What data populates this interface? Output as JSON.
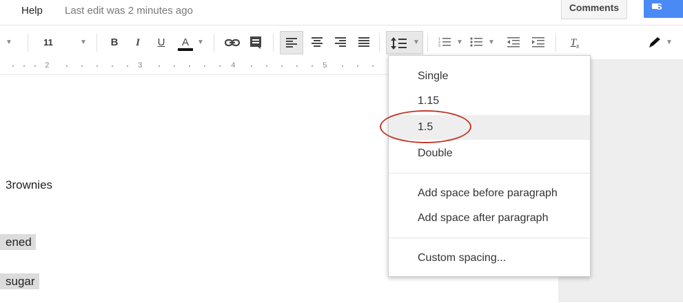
{
  "topbar": {
    "help_label": "Help",
    "last_edit": "Last edit was 2 minutes ago",
    "comments_label": "Comments",
    "share_label": "S"
  },
  "toolbar": {
    "font_size": "11",
    "bold": "B",
    "italic": "I",
    "underline": "U",
    "text_color": "A",
    "link_icon": "link-icon",
    "comment_icon": "insert-comment-icon",
    "align_left_icon": "align-left-icon",
    "align_center_icon": "align-center-icon",
    "align_right_icon": "align-right-icon",
    "align_justify_icon": "align-justify-icon",
    "line_spacing_icon": "line-spacing-icon",
    "numbered_list_icon": "numbered-list-icon",
    "bulleted_list_icon": "bulleted-list-icon",
    "decrease_indent_icon": "decrease-indent-icon",
    "increase_indent_icon": "increase-indent-icon",
    "clear_formatting": "T",
    "editing_icon": "pencil-icon"
  },
  "ruler": {
    "labels": [
      "2",
      "3",
      "4",
      "5"
    ]
  },
  "document": {
    "lines": [
      "3rownies",
      "ened",
      "sugar"
    ]
  },
  "line_spacing_menu": {
    "items": [
      "Single",
      "1.15",
      "1.5",
      "Double"
    ],
    "actions": [
      "Add space before paragraph",
      "Add space after paragraph"
    ],
    "custom": "Custom spacing...",
    "highlighted": "1.5"
  },
  "colors": {
    "annotation_circle": "#c0392b",
    "share_button": "#4a8af4"
  }
}
